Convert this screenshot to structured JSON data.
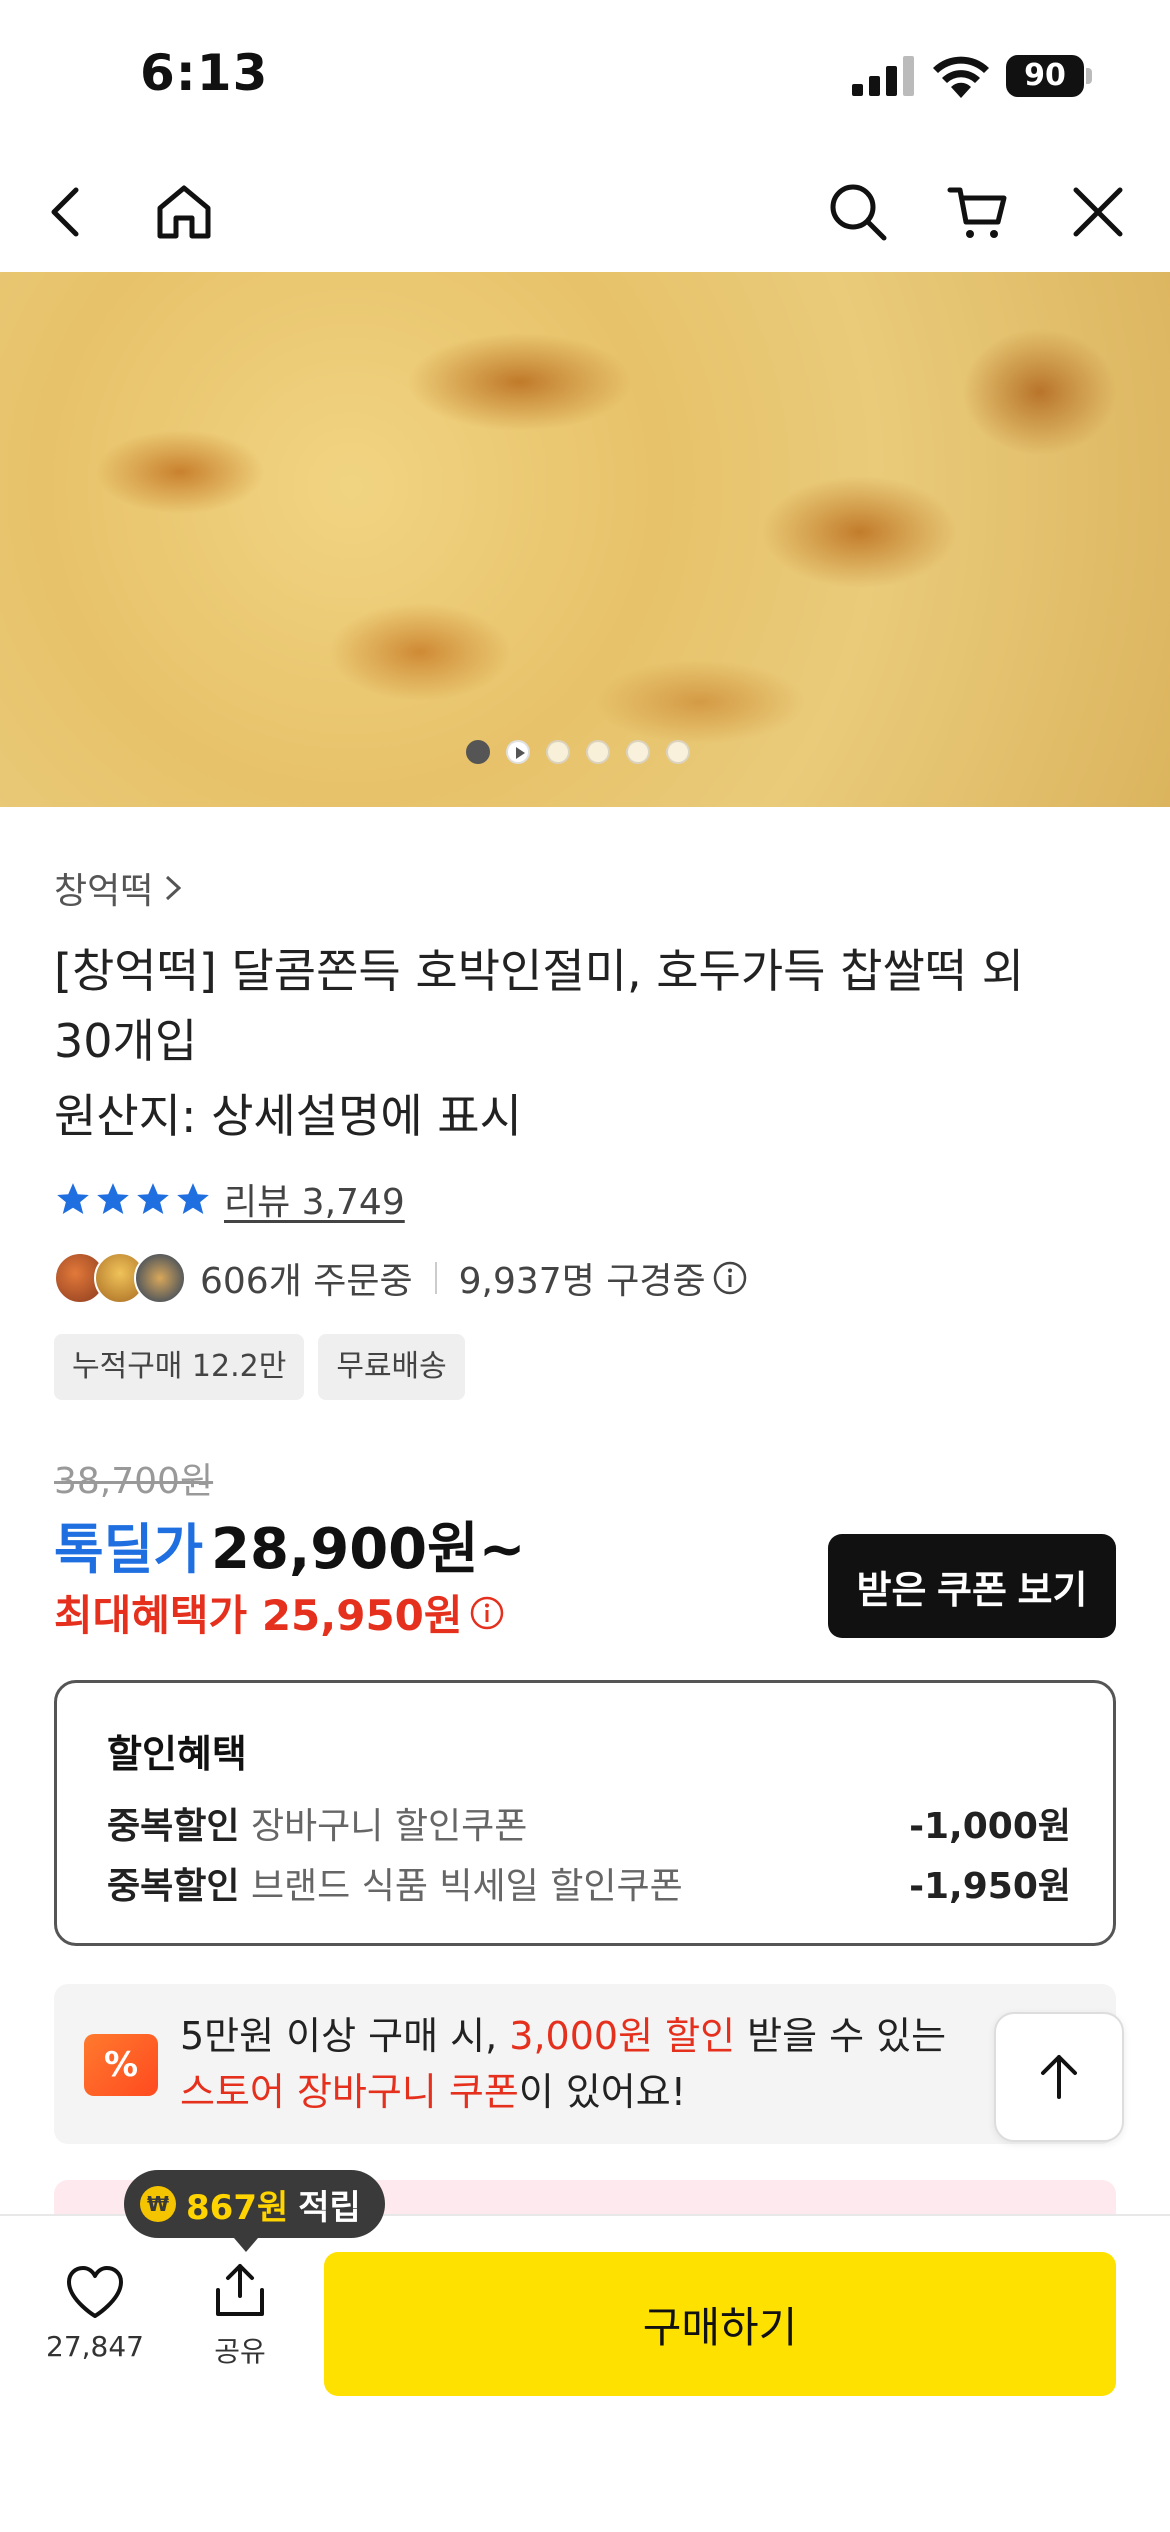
{
  "status_bar": {
    "time": "6:13",
    "battery": "90"
  },
  "nav": {
    "icons": [
      "back-icon",
      "home-icon",
      "search-icon",
      "cart-icon",
      "close-icon"
    ]
  },
  "hero": {
    "slide_count": 6,
    "active_slide": 0
  },
  "product": {
    "brand": "창억떡",
    "title": "[창억떡] 달콤쫀득 호박인절미, 호두가득 찹쌀떡 외 30개입",
    "origin": "원산지: 상세설명에 표시",
    "rating_stars": 4,
    "review_label": "리뷰 3,749",
    "orders": "606개 주문중",
    "viewers": "9,937명 구경중",
    "badges": [
      "누적구매 12.2만",
      "무료배송"
    ]
  },
  "price": {
    "original": "38,700원",
    "deal_label": "톡딜가",
    "deal_price": "28,900원~",
    "max_benefit": "최대혜택가 25,950원",
    "coupon_button": "받은 쿠폰 보기"
  },
  "discount": {
    "title": "할인혜택",
    "lines": [
      {
        "type": "중복할인",
        "name": "장바구니 할인쿠폰",
        "amount": "-1,000원"
      },
      {
        "type": "중복할인",
        "name": "브랜드 식품 빅세일 할인쿠폰",
        "amount": "-1,950원"
      }
    ]
  },
  "promo": {
    "icon_text": "%",
    "part1": "5만원 이상 구매 시, ",
    "highlight1": "3,000원 할인",
    "part2": " 받을 수 있는 ",
    "highlight2": "스토어 장바구니 쿠폰",
    "part3": "이 있어요!"
  },
  "bottom_bar": {
    "like_count": "27,847",
    "share_label": "공유",
    "buy_label": "구매하기",
    "points_amount": "867원",
    "points_suffix": "적립",
    "coin_symbol": "₩"
  },
  "colors": {
    "accent_blue": "#1f6fe0",
    "accent_red": "#e5301e",
    "buy_yellow": "#ffe100"
  }
}
